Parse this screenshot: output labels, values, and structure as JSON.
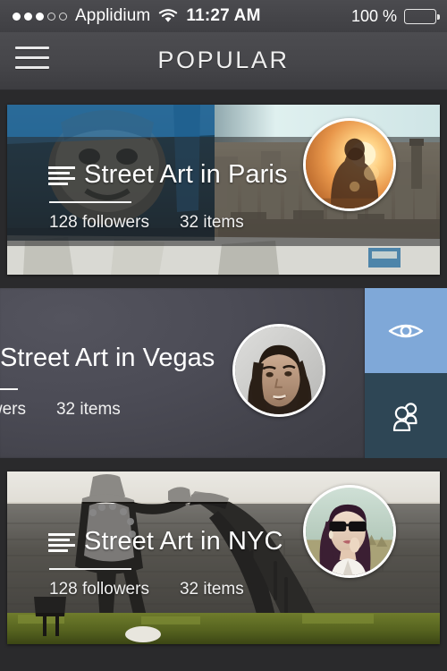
{
  "status_bar": {
    "signal_dots": [
      "filled",
      "filled",
      "filled",
      "empty",
      "empty"
    ],
    "carrier": "Applidium",
    "wifi_icon": "wifi-icon",
    "time": "11:27 AM",
    "battery_percent": "100 %",
    "battery_icon": "battery-full-icon"
  },
  "navbar": {
    "menu_icon": "hamburger-menu-icon",
    "title": "POPULAR"
  },
  "cards": [
    {
      "list_icon": "list-lines-icon",
      "title": "Street Art in Paris",
      "followers": "128 followers",
      "items": "32 items",
      "avatar_icon": "avatar-sunset-silhouette"
    },
    {
      "list_icon": "list-lines-icon",
      "title": "Street Art in Vegas",
      "followers": "followers",
      "items": "32 items",
      "avatar_icon": "avatar-man-long-hair",
      "swiped": "true"
    },
    {
      "list_icon": "list-lines-icon",
      "title": "Street Art in NYC",
      "followers": "128 followers",
      "items": "32 items",
      "avatar_icon": "avatar-woman-sunglasses"
    }
  ],
  "swipe_actions": {
    "view": {
      "icon": "eye-icon",
      "color": "#7fa8d8"
    },
    "follow": {
      "icon": "people-group-icon",
      "color": "#2e4655"
    }
  },
  "colors": {
    "page_background": "#2a2a2c",
    "navbar": "#46464a",
    "status_bar": "#444448",
    "swiped_card": "#4b4b55",
    "text_primary": "#ffffff"
  }
}
